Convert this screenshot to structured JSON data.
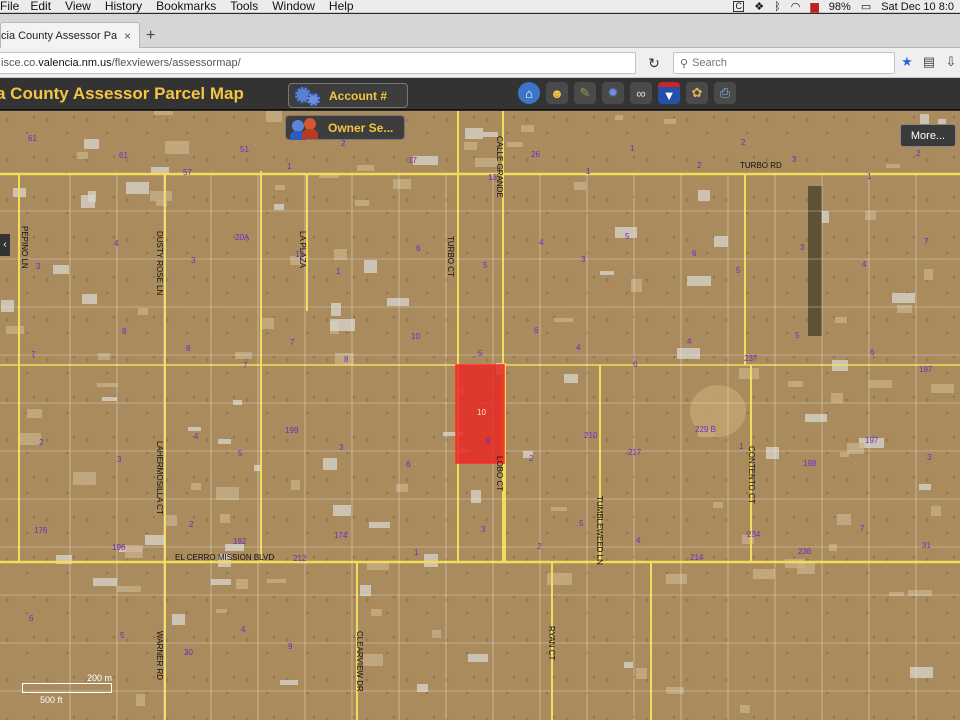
{
  "menubar": {
    "items": [
      "File",
      "Edit",
      "View",
      "History",
      "Bookmarks",
      "Tools",
      "Window",
      "Help"
    ],
    "status_c": "C",
    "battery": "98%",
    "datetime": "Sat Dec 10  8:0"
  },
  "tab": {
    "title": "cia County Assessor Parc...",
    "close": "×",
    "new": "+"
  },
  "navbar": {
    "url_prefix": "isce.co.",
    "url_domain": "valencia.nm.us",
    "url_path": "/flexviewers/assessormap/",
    "search_placeholder": "Search"
  },
  "app": {
    "title": "a County Assessor Parcel Map",
    "account_label": "Account #",
    "owner_label": "Owner Se...",
    "more_label": "More...",
    "pan_left": "‹",
    "colors": {
      "title": "#f4c542",
      "header_bg": "#333333",
      "parcel_highlight": "#e8231f"
    }
  },
  "map": {
    "roads": [
      "TURBO RD",
      "PEPINO LN",
      "DUSTY ROSE LN",
      "LA PLAZA",
      "TURBO CT",
      "CALLE GRANDE",
      "LAHERMOSILLA CT",
      "LOBO CT",
      "TUMBLEWEED LN",
      "CONTENTO CT",
      "EL CERRO MISSION BLVD",
      "WARNER RD",
      "CLEARVIEW DR",
      "RYAN CT"
    ],
    "parcel_numbers": [
      "61",
      "61",
      "57",
      "51",
      "1",
      "2",
      "17",
      "13",
      "26",
      "1",
      "1",
      "2",
      "2",
      "3",
      "1",
      "2",
      "3",
      "4",
      "3",
      "20A",
      "12",
      "1",
      "6",
      "5",
      "4",
      "3",
      "5",
      "6",
      "5",
      "3",
      "4",
      "7",
      "7",
      "8",
      "8",
      "7",
      "7",
      "8",
      "10",
      "5",
      "6",
      "4",
      "6",
      "4",
      "237",
      "5",
      "6",
      "197",
      "2",
      "3",
      "4",
      "5",
      "199",
      "3",
      "6",
      "8",
      "2",
      "210",
      "217",
      "229 B",
      "1",
      "198",
      "197",
      "3",
      "176",
      "196",
      "2",
      "192",
      "212",
      "174",
      "1",
      "3",
      "2",
      "5",
      "4",
      "214",
      "234",
      "236",
      "7",
      "31",
      "6",
      "5",
      "30",
      "4",
      "9"
    ],
    "selected_parcel": "10",
    "scale_metric": "200 m",
    "scale_imperial": "500 ft"
  }
}
